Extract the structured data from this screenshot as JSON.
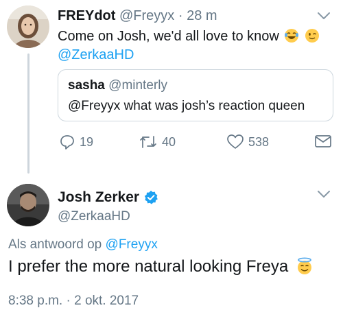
{
  "tweet1": {
    "display_name": "FREYdot",
    "handle": "@Freyyx",
    "separator": "·",
    "time": "28 m",
    "text": "Come on Josh, we'd all love to know",
    "emoji": [
      "laughing-crying-emoji",
      "winking-emoji"
    ],
    "mention": "@ZerkaaHD",
    "quote": {
      "display_name": "sasha",
      "handle": "@minterly",
      "text": "@Freyyx what was josh’s reaction queen"
    },
    "actions": {
      "replies": "19",
      "retweets": "40",
      "likes": "538"
    }
  },
  "tweet2": {
    "display_name": "Josh Zerker",
    "handle": "@ZerkaaHD",
    "reply_prefix": "Als antwoord op",
    "reply_to": "@Freyyx",
    "text": "I prefer the more natural looking Freya",
    "emoji": "halo-smiling-emoji",
    "timestamp": "8:38 p.m. · 2 okt. 2017"
  },
  "colors": {
    "link": "#1da1f2",
    "secondary": "#657786",
    "border": "#ccd6dd",
    "thread_line": "#cdd5dc",
    "verified": "#1da1f2"
  }
}
